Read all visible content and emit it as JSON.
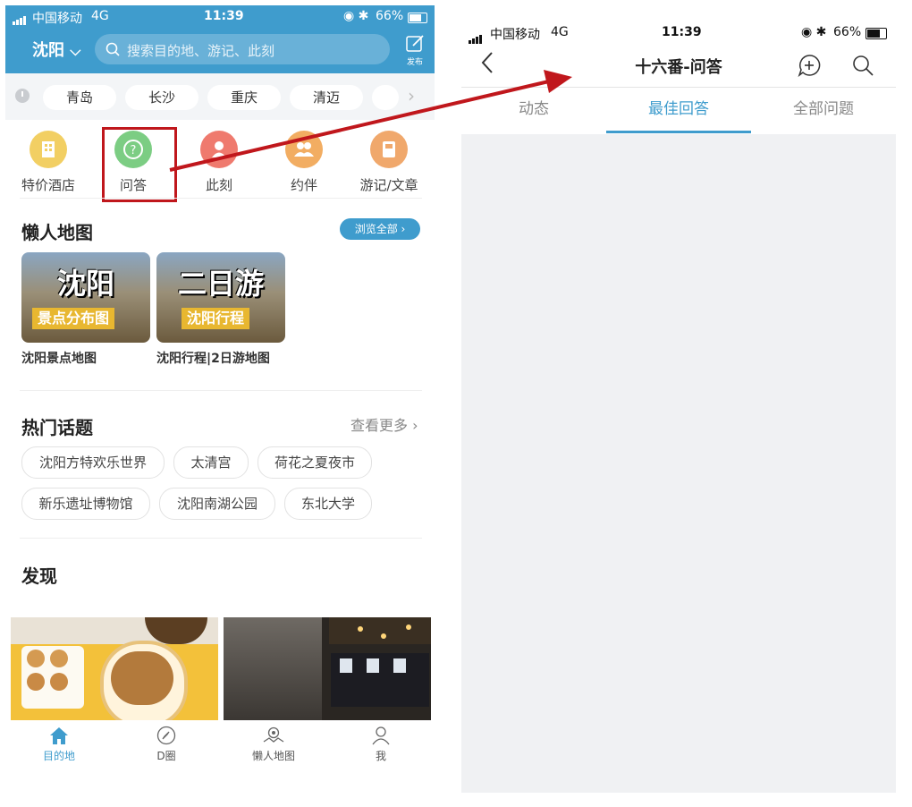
{
  "left": {
    "status": {
      "carrier": "中国移动",
      "network": "4G",
      "time": "11:39",
      "battery": "66%"
    },
    "header": {
      "city": "沈阳",
      "search_placeholder": "搜索目的地、游记、此刻",
      "post_label": "发布"
    },
    "recent_cities": [
      "青岛",
      "长沙",
      "重庆",
      "清迈"
    ],
    "categories": [
      {
        "label": "特价酒店",
        "icon": "hotel-icon",
        "color": "#f2cf63"
      },
      {
        "label": "问答",
        "icon": "question-icon",
        "color": "#7ccd83"
      },
      {
        "label": "此刻",
        "icon": "moment-icon",
        "color": "#ef7a6e"
      },
      {
        "label": "约伴",
        "icon": "companion-icon",
        "color": "#f2ad62"
      },
      {
        "label": "游记/文章",
        "icon": "article-icon",
        "color": "#f0a86c"
      }
    ],
    "lazy_map": {
      "title": "懒人地图",
      "browse_all": "浏览全部 ›",
      "cards": [
        {
          "big": "沈阳",
          "small": "景点分布图",
          "caption": "沈阳景点地图"
        },
        {
          "big": "二日游",
          "small": "沈阳行程",
          "caption": "沈阳行程|2日游地图"
        }
      ]
    },
    "hot_topics": {
      "title": "热门话题",
      "more": "查看更多 ›",
      "row1": [
        "沈阳方特欢乐世界",
        "太清宫",
        "荷花之夏夜市"
      ],
      "row2": [
        "新乐遗址博物馆",
        "沈阳南湖公园",
        "东北大学"
      ]
    },
    "discover": {
      "title": "发现"
    },
    "bottom_nav": [
      {
        "label": "目的地",
        "icon": "home-icon",
        "active": true
      },
      {
        "label": "D圈",
        "icon": "compass-icon",
        "active": false
      },
      {
        "label": "懒人地图",
        "icon": "map-icon",
        "active": false
      },
      {
        "label": "我",
        "icon": "person-icon",
        "active": false
      }
    ]
  },
  "right": {
    "status": {
      "carrier": "中国移动",
      "network": "4G",
      "time": "11:39",
      "battery": "66%"
    },
    "title": "十六番-问答",
    "tabs": [
      "动态",
      "最佳回答",
      "全部问题"
    ],
    "active_tab": 1
  },
  "colors": {
    "brand": "#3f9ccd",
    "highlight": "#c0171c",
    "active_tab": "#3f9ccd"
  }
}
